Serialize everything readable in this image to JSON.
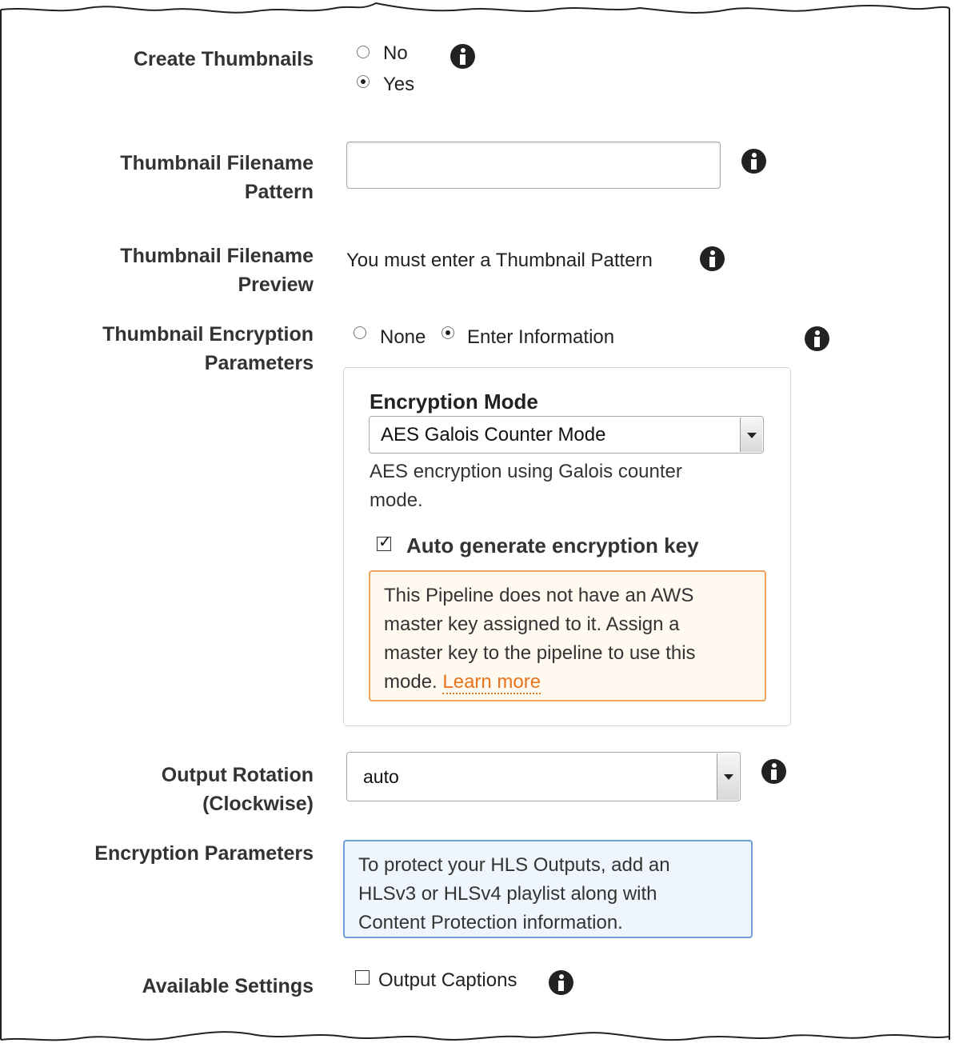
{
  "create_thumbnails": {
    "label": "Create Thumbnails",
    "options": [
      "No",
      "Yes"
    ],
    "selected": "Yes"
  },
  "thumbnail_filename_pattern": {
    "label_line1": "Thumbnail Filename",
    "label_line2": "Pattern",
    "value": ""
  },
  "thumbnail_filename_preview": {
    "label_line1": "Thumbnail Filename",
    "label_line2": "Preview",
    "text": "You must enter a Thumbnail Pattern"
  },
  "thumbnail_encryption": {
    "label_line1": "Thumbnail Encryption",
    "label_line2": "Parameters",
    "options": [
      "None",
      "Enter Information"
    ],
    "selected": "Enter Information",
    "encryption_mode_label": "Encryption Mode",
    "encryption_mode_value": "AES Galois Counter Mode",
    "mode_description_line1": "AES encryption using Galois counter",
    "mode_description_line2": "mode.",
    "auto_generate_label": "Auto generate encryption key",
    "auto_generate_checked": true,
    "warning_line1": "This Pipeline does not have an AWS",
    "warning_line2": "master key assigned to it. Assign a",
    "warning_line3": "master key to the pipeline to use this",
    "warning_line4_prefix": "mode.",
    "warning_link": "Learn more"
  },
  "output_rotation": {
    "label_line1": "Output Rotation",
    "label_line2": "(Clockwise)",
    "value": "auto"
  },
  "encryption_parameters": {
    "label": "Encryption Parameters",
    "note_line1": "To protect your HLS Outputs, add an",
    "note_line2": "HLSv3 or HLSv4 playlist along with",
    "note_line3": "Content Protection information."
  },
  "available_settings": {
    "label": "Available Settings",
    "option": "Output Captions",
    "checked": false
  },
  "colors": {
    "warning_border": "#f0a35b",
    "warning_background": "#fff9f0",
    "link": "#e8741d",
    "note_border": "#6e9fd6",
    "note_background": "#eef5fd"
  }
}
